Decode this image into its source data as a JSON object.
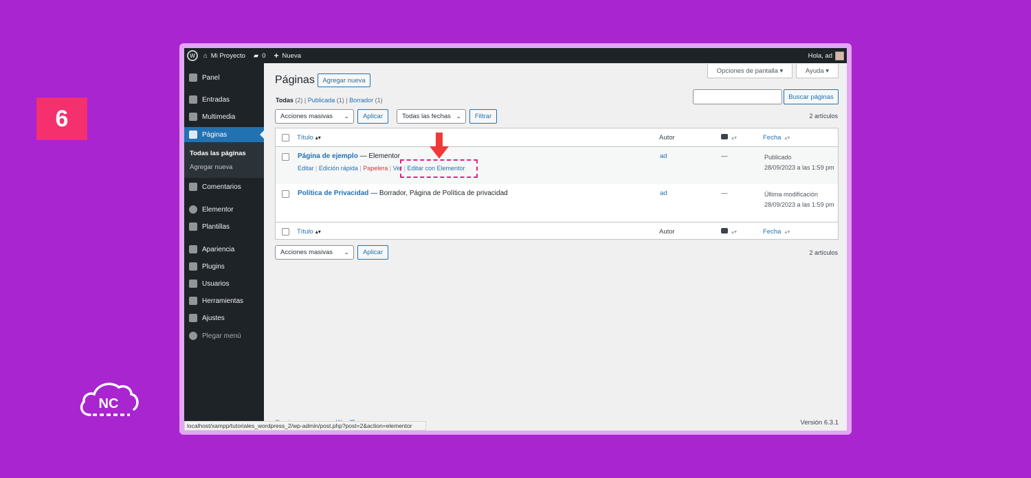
{
  "step_number": "6",
  "logo_text": "NC",
  "adminbar": {
    "site_name": "Mi Proyecto",
    "comments_count": "0",
    "new_label": "Nueva",
    "greeting": "Hola, ad"
  },
  "sidebar": {
    "items": [
      {
        "label": "Panel",
        "icon": "dashboard-icon"
      },
      {
        "label": "Entradas",
        "icon": "pin-icon"
      },
      {
        "label": "Multimedia",
        "icon": "media-icon"
      },
      {
        "label": "Páginas",
        "icon": "pages-icon"
      },
      {
        "label": "Comentarios",
        "icon": "comment-icon"
      },
      {
        "label": "Elementor",
        "icon": "elementor-icon"
      },
      {
        "label": "Plantillas",
        "icon": "folder-icon"
      },
      {
        "label": "Apariencia",
        "icon": "brush-icon"
      },
      {
        "label": "Plugins",
        "icon": "plugin-icon"
      },
      {
        "label": "Usuarios",
        "icon": "user-icon"
      },
      {
        "label": "Herramientas",
        "icon": "wrench-icon"
      },
      {
        "label": "Ajustes",
        "icon": "settings-icon"
      },
      {
        "label": "Plegar menú",
        "icon": "collapse-icon"
      }
    ],
    "submenu": [
      "Todas las páginas",
      "Agregar nueva"
    ]
  },
  "screen_options": "Opciones de pantalla ▾",
  "help": "Ayuda ▾",
  "page_title": "Páginas",
  "add_new": "Agregar nueva",
  "views": {
    "all": "Todas",
    "all_count": "(2)",
    "published": "Publicada",
    "published_count": "(1)",
    "draft": "Borrador",
    "draft_count": "(1)"
  },
  "search_button": "Buscar páginas",
  "bulk_actions": "Acciones masivas",
  "apply": "Aplicar",
  "all_dates": "Todas las fechas",
  "filter": "Filtrar",
  "items_count": "2 artículos",
  "columns": {
    "title": "Título",
    "author": "Autor",
    "date": "Fecha"
  },
  "rows": [
    {
      "title": "Página de ejemplo",
      "state": " — Elementor",
      "author": "ad",
      "comments": "—",
      "date_status": "Publicado",
      "date_value": "28/09/2023 a las 1:59 pm",
      "actions": [
        "Editar",
        "Edición rápida",
        "Papelera",
        "Ver",
        "Editar con Elementor"
      ]
    },
    {
      "title": "Política de Privacidad",
      "state": " — Borrador, Página de Política de privacidad",
      "author": "ad",
      "comments": "—",
      "date_status": "Última modificación",
      "date_value": "28/09/2023 a las 1:59 pm"
    }
  ],
  "footer_text": "Gracias por crear con ",
  "footer_link": "WordPress",
  "version": "Versión 6.3.1",
  "status_url": "localhost/xampp/tutoriales_wordpress_2/wp-admin/post.php?post=2&action=elementor",
  "colors": {
    "background": "#a825cf",
    "badge": "#f4306f",
    "wp_blue": "#2271b1",
    "highlight": "#e0237e",
    "arrow": "#f03a3a"
  }
}
